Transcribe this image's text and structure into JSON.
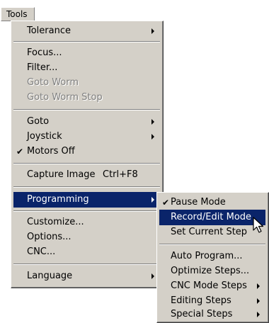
{
  "menubar": {
    "title": "Tools"
  },
  "tools_menu": {
    "items": [
      {
        "label": "Tolerance",
        "has_submenu": true
      },
      {
        "label": "Focus..."
      },
      {
        "label": "Filter..."
      },
      {
        "label": "Goto Worm",
        "disabled": true
      },
      {
        "label": "Goto Worm Stop",
        "disabled": true
      },
      {
        "label": "Goto",
        "has_submenu": true
      },
      {
        "label": "Joystick",
        "has_submenu": true
      },
      {
        "label": "Motors Off",
        "checked": true
      },
      {
        "label": "Capture Image",
        "shortcut": "Ctrl+F8"
      },
      {
        "label": "Programming",
        "has_submenu": true,
        "highlighted": true
      },
      {
        "label": "Customize..."
      },
      {
        "label": "Options..."
      },
      {
        "label": "CNC..."
      },
      {
        "label": "Language",
        "has_submenu": true
      }
    ]
  },
  "programming_submenu": {
    "items": [
      {
        "label": "Pause Mode",
        "checked": true
      },
      {
        "label": "Record/Edit Mode",
        "highlighted": true
      },
      {
        "label": "Set Current Step"
      },
      {
        "label": "Auto Program..."
      },
      {
        "label": "Optimize Steps..."
      },
      {
        "label": "CNC Mode Steps",
        "has_submenu": true
      },
      {
        "label": "Editing Steps",
        "has_submenu": true
      },
      {
        "label": "Special Steps",
        "has_submenu": true
      }
    ]
  },
  "glyphs": {
    "check": "✔"
  },
  "colors": {
    "menu_background": "#d4d0c8",
    "highlight": "#0a246a",
    "disabled_text": "#808080"
  }
}
